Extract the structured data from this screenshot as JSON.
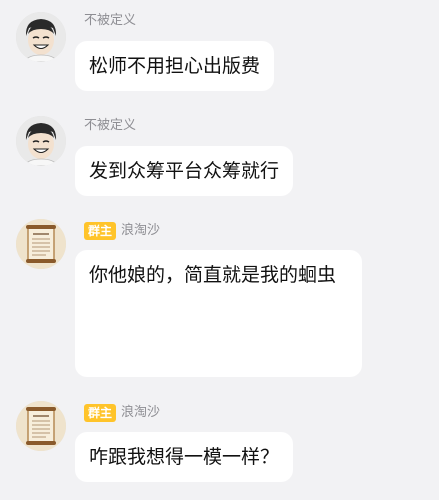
{
  "messages": [
    {
      "sender": "不被定义",
      "badge": "",
      "text": "松师不用担心出版费",
      "avatar": "man-smiling-avatar"
    },
    {
      "sender": "不被定义",
      "badge": "",
      "text": "发到众筹平台众筹就行",
      "avatar": "man-smiling-avatar"
    },
    {
      "sender": "浪淘沙",
      "badge": "群主",
      "text": "你他娘的，简直就是我的蛔虫",
      "avatar": "scroll-document-avatar"
    },
    {
      "sender": "浪淘沙",
      "badge": "群主",
      "text": "咋跟我想得一模一样？",
      "avatar": "scroll-document-avatar"
    }
  ],
  "colors": {
    "background": "#f2f2f4",
    "bubble": "#ffffff",
    "badge": "#ffc42a",
    "sender_text": "#8e8e93"
  }
}
